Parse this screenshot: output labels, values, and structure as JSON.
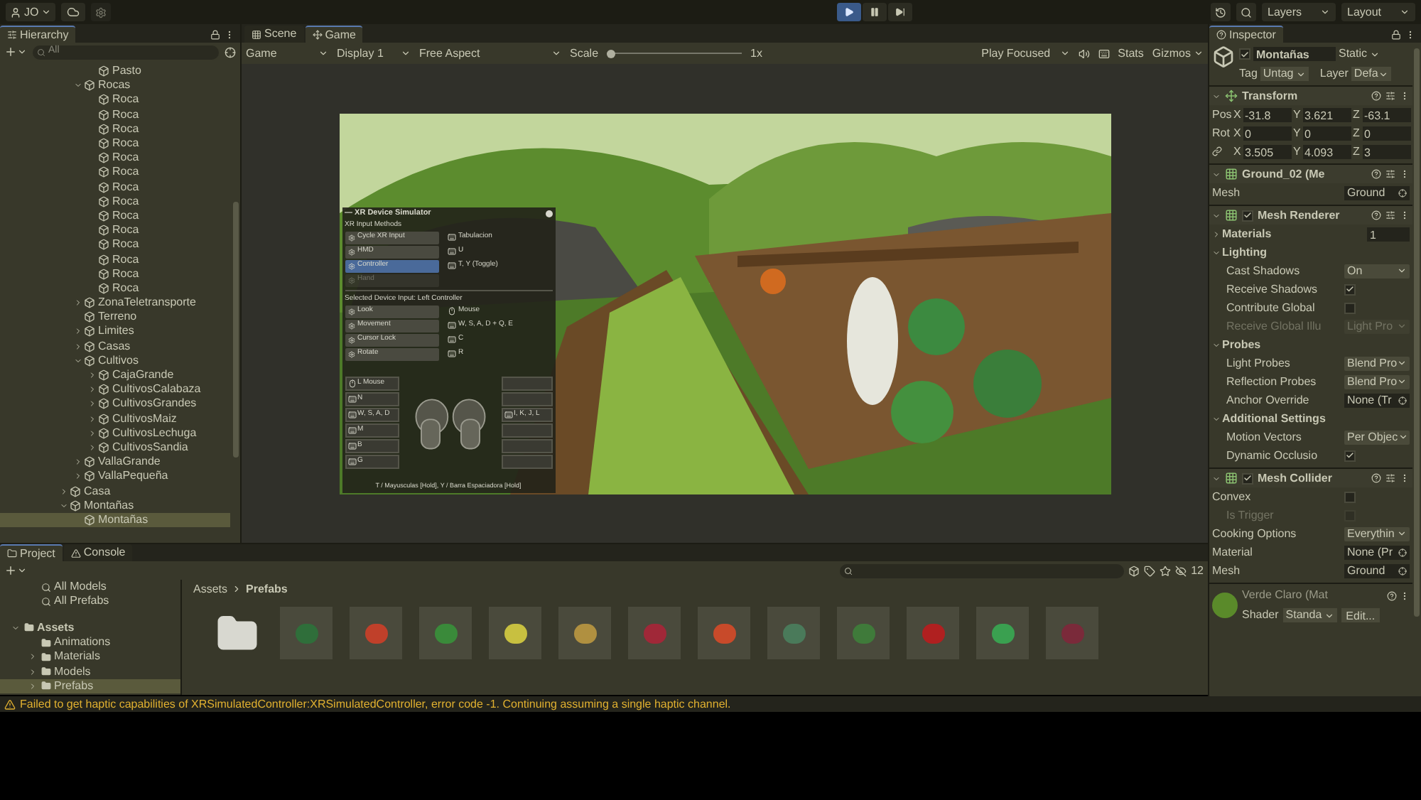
{
  "toolbar": {
    "account": "JO",
    "play_buttons": [
      {
        "kind": "play",
        "selected": true
      },
      {
        "kind": "pause",
        "selected": false
      },
      {
        "kind": "step",
        "selected": false
      }
    ],
    "layers": "Layers",
    "layout": "Layout"
  },
  "hierarchy": {
    "tab": "Hierarchy",
    "search_placeholder": "All",
    "partial_items": [
      {
        "label": "Pasto",
        "selected": false
      }
    ],
    "nested_items": [
      {
        "label": "Rocas",
        "selected": false,
        "expanded": true,
        "children": [
          {
            "label": "Roca",
            "selected": false
          },
          {
            "label": "Roca",
            "selected": false
          },
          {
            "label": "Roca",
            "selected": false
          },
          {
            "label": "Roca",
            "selected": false
          },
          {
            "label": "Roca",
            "selected": false
          },
          {
            "label": "Roca",
            "selected": false
          },
          {
            "label": "Roca",
            "selected": false
          },
          {
            "label": "Roca",
            "selected": false
          },
          {
            "label": "Roca",
            "selected": false
          },
          {
            "label": "Roca",
            "selected": false
          },
          {
            "label": "Roca",
            "selected": false
          },
          {
            "label": "Roca",
            "selected": false
          },
          {
            "label": "Roca",
            "selected": false
          },
          {
            "label": "Roca",
            "selected": false
          }
        ]
      },
      {
        "label": "ZonaTeletransporte",
        "selected": false,
        "expanded": false
      },
      {
        "label": "Terreno",
        "selected": false
      },
      {
        "label": "Limites",
        "selected": false,
        "expanded": false
      },
      {
        "label": "Casas",
        "selected": false,
        "expanded": false
      },
      {
        "label": "Cultivos",
        "selected": false,
        "expanded": true,
        "children": [
          {
            "label": "CajaGrande",
            "selected": false,
            "expanded": false
          },
          {
            "label": "CultivosCalabaza",
            "selected": false,
            "expanded": false
          },
          {
            "label": "CultivosGrandes",
            "selected": false,
            "expanded": false
          },
          {
            "label": "CultivosMaiz",
            "selected": false,
            "expanded": false
          },
          {
            "label": "CultivosLechuga",
            "selected": false,
            "expanded": false
          },
          {
            "label": "CultivosSandia",
            "selected": false,
            "expanded": false
          }
        ]
      },
      {
        "label": "VallaGrande",
        "selected": false,
        "expanded": false
      },
      {
        "label": "VallaPequeña",
        "selected": false,
        "expanded": false
      }
    ],
    "root_items": [
      {
        "label": "Casa",
        "selected": false,
        "expanded": false
      },
      {
        "label": "Montañas",
        "selected": false,
        "expanded": true,
        "children": [
          {
            "label": "Montañas",
            "selected": true
          }
        ]
      }
    ]
  },
  "game": {
    "tabs": [
      {
        "label": "Scene",
        "selected": false
      },
      {
        "label": "Game",
        "selected": true
      }
    ],
    "toolbar": {
      "view": "Game",
      "display": "Display 1",
      "aspect": "Free Aspect",
      "scale_label": "Scale",
      "scale": {
        "level": 0.0,
        "reading": "1x"
      },
      "play_mode": "Play Focused",
      "stats": "Stats",
      "gizmos": "Gizmos"
    },
    "xr_simulator": {
      "title": "— XR Device Simulator",
      "input_methods_label": "XR Input Methods",
      "input_methods": [
        {
          "label": "Cycle XR Input",
          "selected": false,
          "disabled": false
        },
        {
          "label": "HMD",
          "selected": false,
          "disabled": false
        },
        {
          "label": "Controller",
          "selected": true,
          "disabled": false
        },
        {
          "label": "Hand",
          "selected": false,
          "disabled": true
        }
      ],
      "method_keys": [
        "Tabulacion",
        "U",
        "T, Y (Toggle)"
      ],
      "device_label": "Selected Device Input: Left Controller",
      "device_modes": [
        {
          "label": "Look",
          "selected": false
        },
        {
          "label": "Movement",
          "selected": false
        },
        {
          "label": "Cursor Lock",
          "selected": false
        },
        {
          "label": "Rotate",
          "selected": false
        }
      ],
      "device_keys": [
        {
          "kind": "mouse",
          "label": "Mouse"
        },
        {
          "kind": "keyboard",
          "label": "W, S, A, D + Q, E"
        },
        {
          "kind": "keyboard",
          "label": "C"
        },
        {
          "kind": "keyboard",
          "label": "R"
        }
      ],
      "left_bindings": [
        {
          "kind": "mouse",
          "label": "L Mouse"
        },
        {
          "kind": "keyboard",
          "label": "N"
        },
        {
          "kind": "keyboard",
          "label": "W, S, A, D"
        },
        {
          "kind": "keyboard",
          "label": "M"
        },
        {
          "kind": "keyboard",
          "label": "B"
        },
        {
          "kind": "keyboard",
          "label": "G"
        }
      ],
      "right_bindings": [
        {
          "kind": "empty"
        },
        {
          "kind": "empty"
        },
        {
          "kind": "keyboard",
          "label": "I, K, J, L"
        },
        {
          "kind": "empty"
        },
        {
          "kind": "empty"
        },
        {
          "kind": "empty"
        }
      ],
      "footer": "T / Mayusculas [Hold], Y / Barra Espaciadora [Hold]"
    }
  },
  "inspector": {
    "tab": "Inspector",
    "object": {
      "active": true,
      "name": "Montañas",
      "static": "Static",
      "tag_label": "Tag",
      "tag": "Untag",
      "layer_label": "Layer",
      "layer": "Defa"
    },
    "components": [
      {
        "kind": "transform",
        "title": "Transform",
        "rows": [
          {
            "label": "Pos",
            "linked": false,
            "axes": [
              {
                "axis": "X",
                "value": "-31.8"
              },
              {
                "axis": "Y",
                "value": "3.621"
              },
              {
                "axis": "Z",
                "value": "-63.1"
              }
            ]
          },
          {
            "label": "Rot",
            "linked": false,
            "axes": [
              {
                "axis": "X",
                "value": "0"
              },
              {
                "axis": "Y",
                "value": "0"
              },
              {
                "axis": "Z",
                "value": "0"
              }
            ]
          },
          {
            "linked": true,
            "axes": [
              {
                "axis": "X",
                "value": "3.505"
              },
              {
                "axis": "Y",
                "value": "4.093"
              },
              {
                "axis": "Z",
                "value": "3"
              }
            ]
          }
        ]
      },
      {
        "kind": "mesh_filter",
        "title": "Ground_02 (Me",
        "rows": [
          {
            "kind": "object",
            "label": "Mesh",
            "value": "Ground",
            "disabled": false
          }
        ]
      },
      {
        "kind": "mesh_renderer",
        "title": "Mesh Renderer",
        "enabled": true,
        "rows": [
          {
            "kind": "foldout",
            "label": "Materials",
            "value": "1",
            "expanded": false,
            "disabled": false
          },
          {
            "kind": "section",
            "label": "Lighting",
            "expanded": true,
            "disabled": false,
            "children": [
              {
                "kind": "dropdown",
                "label": "Cast Shadows",
                "value": "On",
                "disabled": false
              },
              {
                "kind": "checkbox",
                "label": "Receive Shadows",
                "checked": true,
                "disabled": false
              },
              {
                "kind": "checkbox",
                "label": "Contribute Global",
                "checked": false,
                "disabled": false
              },
              {
                "kind": "dropdown",
                "label": "Receive Global Illu",
                "value": "Light Pro",
                "disabled": true
              }
            ]
          },
          {
            "kind": "section",
            "label": "Probes",
            "expanded": true,
            "disabled": false,
            "children": [
              {
                "kind": "dropdown",
                "label": "Light Probes",
                "value": "Blend Pro",
                "disabled": false
              },
              {
                "kind": "dropdown",
                "label": "Reflection Probes",
                "value": "Blend Pro",
                "disabled": false
              },
              {
                "kind": "object",
                "label": "Anchor Override",
                "value": "None (Tr",
                "disabled": false
              }
            ]
          },
          {
            "kind": "section",
            "label": "Additional Settings",
            "expanded": true,
            "disabled": false,
            "children": [
              {
                "kind": "dropdown",
                "label": "Motion Vectors",
                "value": "Per Objec",
                "disabled": false
              },
              {
                "kind": "checkbox",
                "label": "Dynamic Occlusio",
                "checked": true,
                "disabled": false
              }
            ]
          }
        ]
      },
      {
        "kind": "mesh_collider",
        "title": "Mesh Collider",
        "enabled": true,
        "rows": [
          {
            "kind": "checkbox",
            "label": "Convex",
            "checked": false,
            "disabled": false,
            "children": [
              {
                "kind": "checkbox",
                "label": "Is Trigger",
                "checked": false,
                "disabled": true
              }
            ]
          },
          {
            "kind": "dropdown",
            "label": "Cooking Options",
            "value": "Everythin",
            "disabled": false
          },
          {
            "kind": "object",
            "label": "Material",
            "value": "None (Pr",
            "disabled": false
          },
          {
            "kind": "object",
            "label": "Mesh",
            "value": "Ground",
            "disabled": false
          }
        ]
      }
    ],
    "material": {
      "name": "Verde Claro (Mat",
      "shader_label": "Shader",
      "shader": "Standa",
      "edit": "Edit..."
    }
  },
  "project": {
    "tabs": [
      {
        "label": "Project",
        "selected": true
      },
      {
        "label": "Console",
        "selected": false
      }
    ],
    "asset_count": "12",
    "tree": [
      {
        "kind": "search",
        "label": "All Models",
        "selected": false
      },
      {
        "kind": "search",
        "label": "All Prefabs",
        "selected": false
      },
      {
        "kind": "folder",
        "label": "Assets",
        "selected": false,
        "expanded": true,
        "children": [
          {
            "kind": "folder",
            "label": "Animations",
            "selected": false
          },
          {
            "kind": "folder",
            "label": "Materials",
            "selected": false,
            "expanded": false
          },
          {
            "kind": "folder",
            "label": "Models",
            "selected": false,
            "expanded": false
          },
          {
            "kind": "folder",
            "label": "Prefabs",
            "selected": true,
            "expanded": false
          }
        ]
      }
    ],
    "breadcrumb": [
      "Assets",
      "Prefabs"
    ],
    "assets": [
      {
        "kind": "folder"
      },
      {
        "kind": "model",
        "color": "#2f6e3a"
      },
      {
        "kind": "model",
        "color": "#c0402a"
      },
      {
        "kind": "model",
        "color": "#3a8a3a"
      },
      {
        "kind": "model",
        "color": "#c8c040"
      },
      {
        "kind": "model",
        "color": "#b09040"
      },
      {
        "kind": "model",
        "color": "#a02838"
      },
      {
        "kind": "model",
        "color": "#c84a2a"
      },
      {
        "kind": "model",
        "color": "#4a7a5a"
      },
      {
        "kind": "model",
        "color": "#3f7a3a"
      },
      {
        "kind": "model",
        "color": "#b02020"
      },
      {
        "kind": "model",
        "color": "#3aa050"
      },
      {
        "kind": "model",
        "color": "#7a2a3a"
      }
    ]
  },
  "status": {
    "kind": "warning",
    "message": "Failed to get haptic capabilities of XRSimulatedController:XRSimulatedController, error code -1. Continuing assuming a single haptic channel."
  }
}
